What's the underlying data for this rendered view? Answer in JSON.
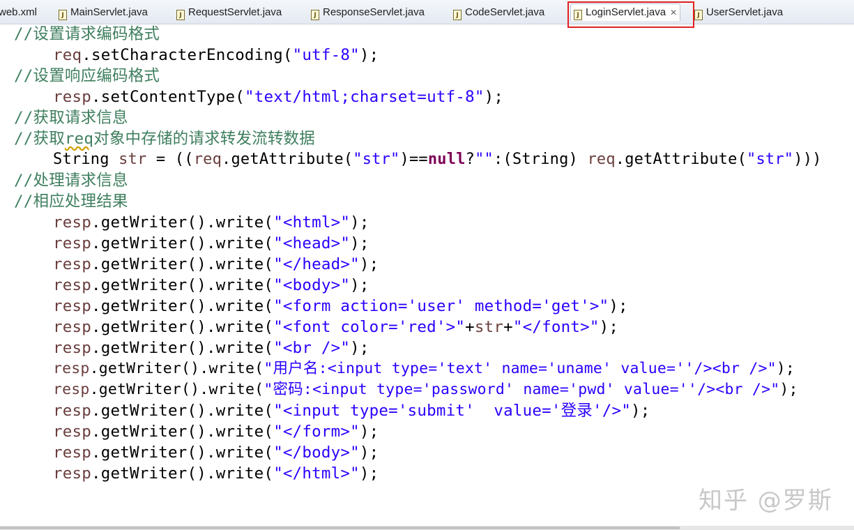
{
  "tabs": [
    {
      "label": "web.xml",
      "active": false
    },
    {
      "label": "MainServlet.java",
      "active": false
    },
    {
      "label": "RequestServlet.java",
      "active": false
    },
    {
      "label": "ResponseServlet.java",
      "active": false
    },
    {
      "label": "CodeServlet.java",
      "active": false
    },
    {
      "label": "LoginServlet.java",
      "active": true
    },
    {
      "label": "UserServlet.java",
      "active": false
    }
  ],
  "code": {
    "l1": {
      "c": "//设置请求编码格式"
    },
    "l2": {
      "v": "req",
      "a": ".setCharacterEncoding(",
      "s": "\"utf-8\"",
      "b": ");"
    },
    "l3": {
      "c": "//设置响应编码格式"
    },
    "l4": {
      "v": "resp",
      "a": ".setContentType(",
      "s": "\"text/html;charset=utf-8\"",
      "b": ");"
    },
    "l5": {
      "c": "//获取请求信息"
    },
    "l6": {
      "c1": "//获取",
      "cu": "req",
      "c2": "对象中存储的请求转发流转数据"
    },
    "l7": {
      "t1": "String ",
      "v1": "str",
      "t2": " = ((",
      "v2": "req",
      "t3": ".getAttribute(",
      "s1": "\"str\"",
      "t4": ")==",
      "k": "null",
      "t5": "?",
      "s2": "\"\"",
      "t6": ":(String) ",
      "v3": "req",
      "t7": ".getAttribute(",
      "s3": "\"str\"",
      "t8": ")))"
    },
    "l8": {
      "c": "//处理请求信息"
    },
    "l9": {
      "c": "//相应处理结果"
    },
    "writes": [
      {
        "v": "resp",
        "a": ".getWriter().write(",
        "s": "\"<html>\"",
        "b": ");"
      },
      {
        "v": "resp",
        "a": ".getWriter().write(",
        "s": "\"<head>\"",
        "b": ");"
      },
      {
        "v": "resp",
        "a": ".getWriter().write(",
        "s": "\"</head>\"",
        "b": ");"
      },
      {
        "v": "resp",
        "a": ".getWriter().write(",
        "s": "\"<body>\"",
        "b": ");"
      },
      {
        "v": "resp",
        "a": ".getWriter().write(",
        "s": "\"<form action='user' method='get'>\"",
        "b": ");"
      },
      {
        "v": "resp",
        "a": ".getWriter().write(",
        "s": "\"<font color='red'>\"",
        "m1": "+",
        "mv": "str",
        "m2": "+",
        "s2": "\"</font>\"",
        "b": ");"
      },
      {
        "v": "resp",
        "a": ".getWriter().write(",
        "s": "\"<br />\"",
        "b": ");"
      },
      {
        "v": "resp",
        "a": ".getWriter().write(",
        "s": "\"用户名:<input type='text' name='uname' value=''/><br />\"",
        "b": ");"
      },
      {
        "v": "resp",
        "a": ".getWriter().write(",
        "s": "\"密码:<input type='password' name='pwd' value=''/><br />\"",
        "b": ");"
      },
      {
        "v": "resp",
        "a": ".getWriter().write(",
        "s": "\"<input type='submit'  value='登录'/>\"",
        "b": ");"
      },
      {
        "v": "resp",
        "a": ".getWriter().write(",
        "s": "\"</form>\"",
        "b": ");"
      },
      {
        "v": "resp",
        "a": ".getWriter().write(",
        "s": "\"</body>\"",
        "b": ");"
      },
      {
        "v": "resp",
        "a": ".getWriter().write(",
        "s": "\"</html>\"",
        "b": ");"
      }
    ]
  },
  "watermark": "知乎 @罗斯",
  "colors": {
    "comment": "#3f7f5f",
    "string": "#2a00ff",
    "variable": "#6a3e3e",
    "keyword": "#7f0055",
    "highlight": "#e02020"
  }
}
